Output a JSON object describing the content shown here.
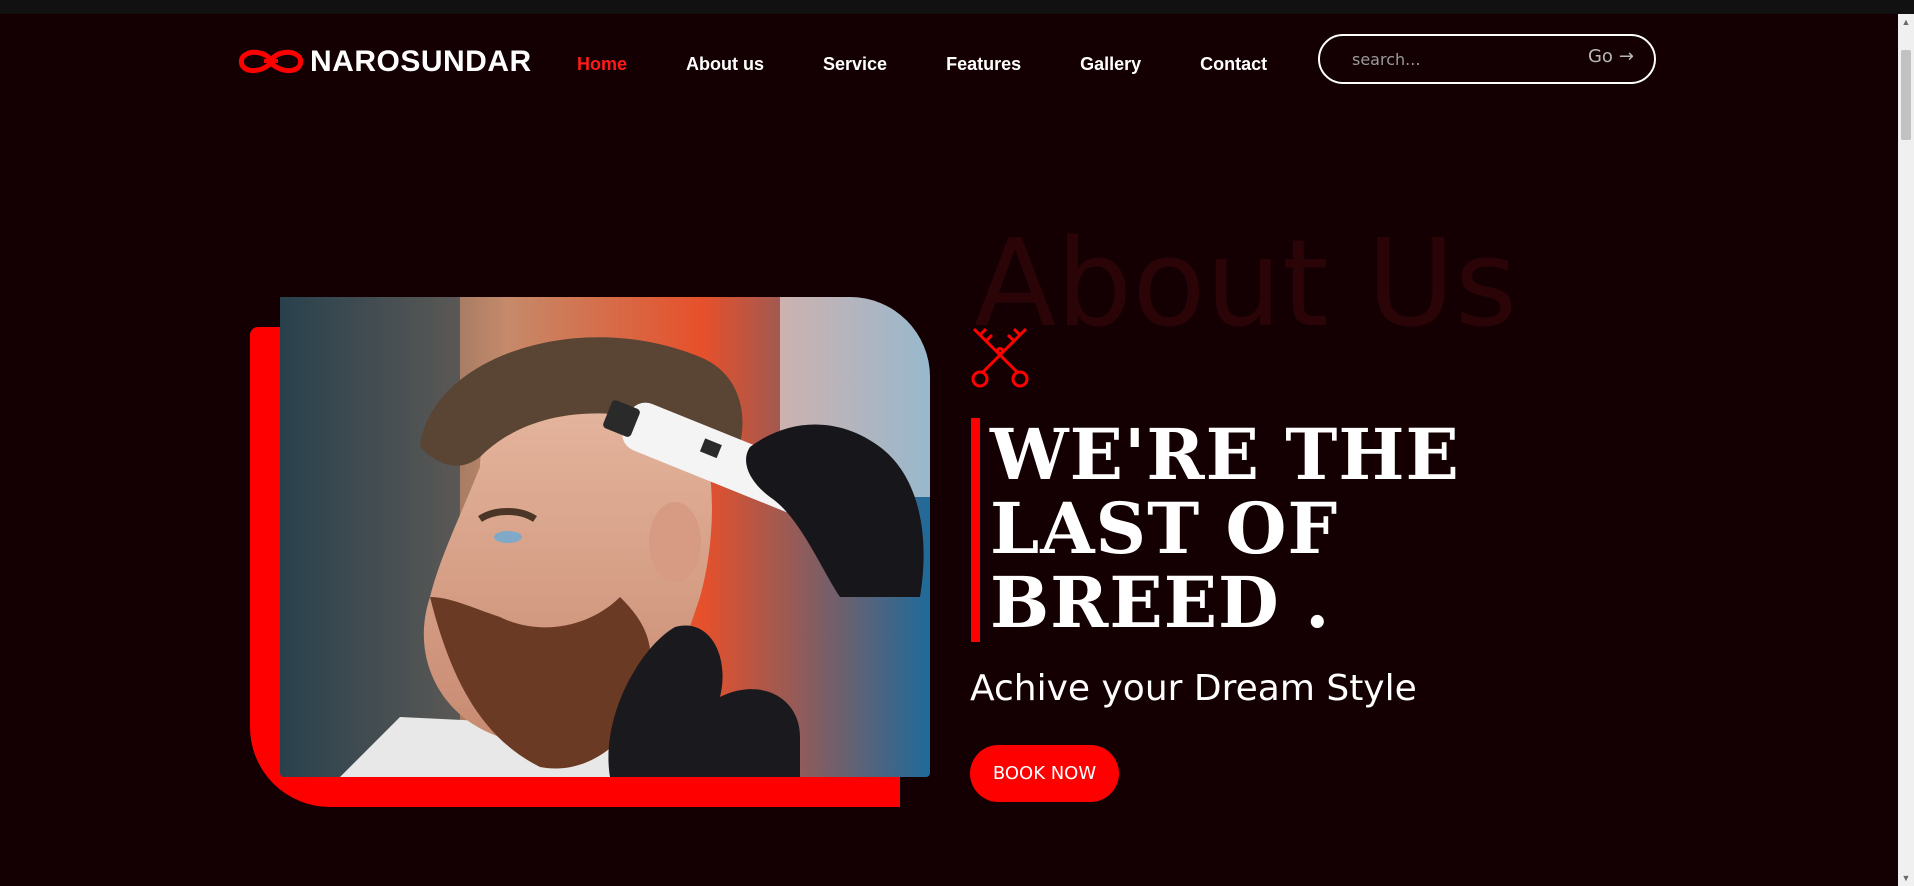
{
  "brand": {
    "name": "NAROSUNDAR",
    "accent": "#ff0000",
    "background": "#140003"
  },
  "nav": {
    "items": [
      {
        "label": "Home",
        "active": true
      },
      {
        "label": "About us"
      },
      {
        "label": "Service"
      },
      {
        "label": "Features"
      },
      {
        "label": "Gallery"
      },
      {
        "label": "Contact"
      }
    ]
  },
  "search": {
    "placeholder": "search...",
    "go_label": "Go",
    "go_icon": "arrow-right-icon"
  },
  "hero": {
    "ghost_title": "About Us",
    "icon": "scissors-icon",
    "headline": [
      "WE'RE THE",
      "LAST OF",
      "BREED ."
    ],
    "tagline": "Achive your Dream Style",
    "cta_label": "BOOK NOW",
    "image": "barber-trimming-bearded-man"
  }
}
